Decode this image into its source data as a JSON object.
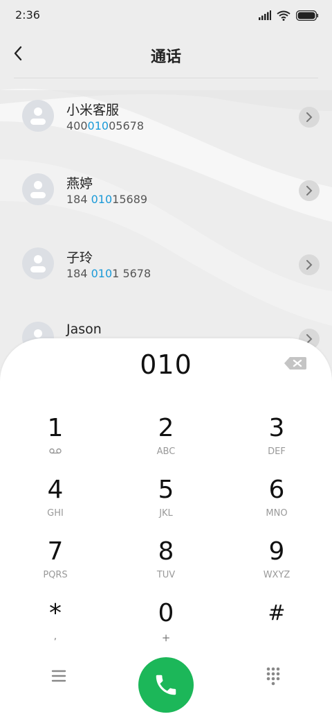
{
  "status_bar": {
    "time": "2:36"
  },
  "header": {
    "title": "通话"
  },
  "contacts": [
    {
      "name": "小米客服",
      "number_parts": [
        "400",
        "010",
        "05678"
      ]
    },
    {
      "name": "燕婷",
      "number_parts": [
        "184 ",
        "010",
        "15689"
      ]
    },
    {
      "name": "子玲",
      "number_parts": [
        "184 ",
        "010",
        "1 5678"
      ]
    },
    {
      "name": "Jason",
      "number_parts": [
        "",
        "",
        ""
      ]
    }
  ],
  "dialer": {
    "input": "010",
    "keys": [
      {
        "digit": "1",
        "letters": ""
      },
      {
        "digit": "2",
        "letters": "ABC"
      },
      {
        "digit": "3",
        "letters": "DEF"
      },
      {
        "digit": "4",
        "letters": "GHI"
      },
      {
        "digit": "5",
        "letters": "JKL"
      },
      {
        "digit": "6",
        "letters": "MNO"
      },
      {
        "digit": "7",
        "letters": "PQRS"
      },
      {
        "digit": "8",
        "letters": "TUV"
      },
      {
        "digit": "9",
        "letters": "WXYZ"
      },
      {
        "digit": "*",
        "letters": ","
      },
      {
        "digit": "0",
        "letters": "+"
      },
      {
        "digit": "#",
        "letters": ""
      }
    ]
  },
  "icons": {
    "back": "back-arrow-icon",
    "voicemail": "voicemail-icon",
    "backspace": "backspace-icon",
    "menu": "menu-icon",
    "call": "phone-icon",
    "keypad": "keypad-icon"
  },
  "colors": {
    "highlight": "#1a9ad8",
    "call": "#1cb759"
  }
}
